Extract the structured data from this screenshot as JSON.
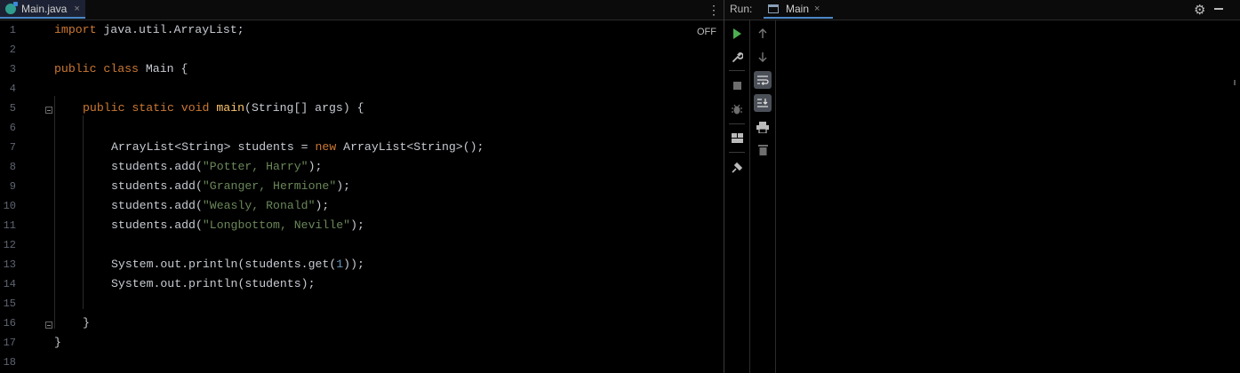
{
  "editor": {
    "tab": {
      "name": "Main.java",
      "close": "×",
      "icon": "java-file-icon"
    },
    "menu_glyph": "⋮",
    "off_label": "OFF",
    "line_numbers": [
      "1",
      "2",
      "3",
      "4",
      "5",
      "6",
      "7",
      "8",
      "9",
      "10",
      "11",
      "12",
      "13",
      "14",
      "15",
      "16",
      "17",
      "18"
    ]
  },
  "code": {
    "l1": {
      "kw": "import",
      "rest": " java.util.ArrayList;"
    },
    "l3": {
      "kw1": "public",
      "kw2": " class",
      "rest": " Main {"
    },
    "l5": {
      "kw1": "public",
      "kw2": " static",
      "kw3": " void",
      "fn": " main",
      "rest": "(String[] args) {"
    },
    "l7": {
      "pre": "ArrayList<String> students = ",
      "kw": "new",
      "post": " ArrayList<String>();"
    },
    "l8": {
      "pre": "students.add(",
      "str": "\"Potter, Harry\"",
      "post": ");"
    },
    "l9": {
      "pre": "students.add(",
      "str": "\"Granger, Hermione\"",
      "post": ");"
    },
    "l10": {
      "pre": "students.add(",
      "str": "\"Weasly, Ronald\"",
      "post": ");"
    },
    "l11": {
      "pre": "students.add(",
      "str": "\"Longbottom, Neville\"",
      "post": ");"
    },
    "l13": {
      "pre": "System.out.println(students.get(",
      "num": "1",
      "post": "));"
    },
    "l14": {
      "text": "System.out.println(students);"
    },
    "l16": {
      "text": "}"
    },
    "l17": {
      "text": "}"
    }
  },
  "run": {
    "label": "Run:",
    "tab": {
      "name": "Main",
      "close": "×",
      "icon": "console-icon"
    },
    "settings_icon": "gear-icon",
    "hide_icon": "minimize-icon"
  },
  "toolbar": {
    "rerun_icon": "play-icon",
    "settings_icon": "wrench-icon",
    "stop_icon": "stop-icon",
    "debug_icon": "bug-icon",
    "layout_icon": "layout-icon",
    "pin_icon": "pin-icon",
    "up_icon": "arrow-up-icon",
    "down_icon": "arrow-down-icon",
    "wrap_icon": "soft-wrap-icon",
    "scroll_end_icon": "scroll-to-end-icon",
    "print_icon": "print-icon",
    "trash_icon": "trash-icon"
  },
  "colors": {
    "keyword": "#cc7832",
    "string": "#6a8759",
    "number": "#6897bb",
    "function": "#ffc66d",
    "accent": "#4a88c7",
    "run_green": "#4caf50"
  }
}
